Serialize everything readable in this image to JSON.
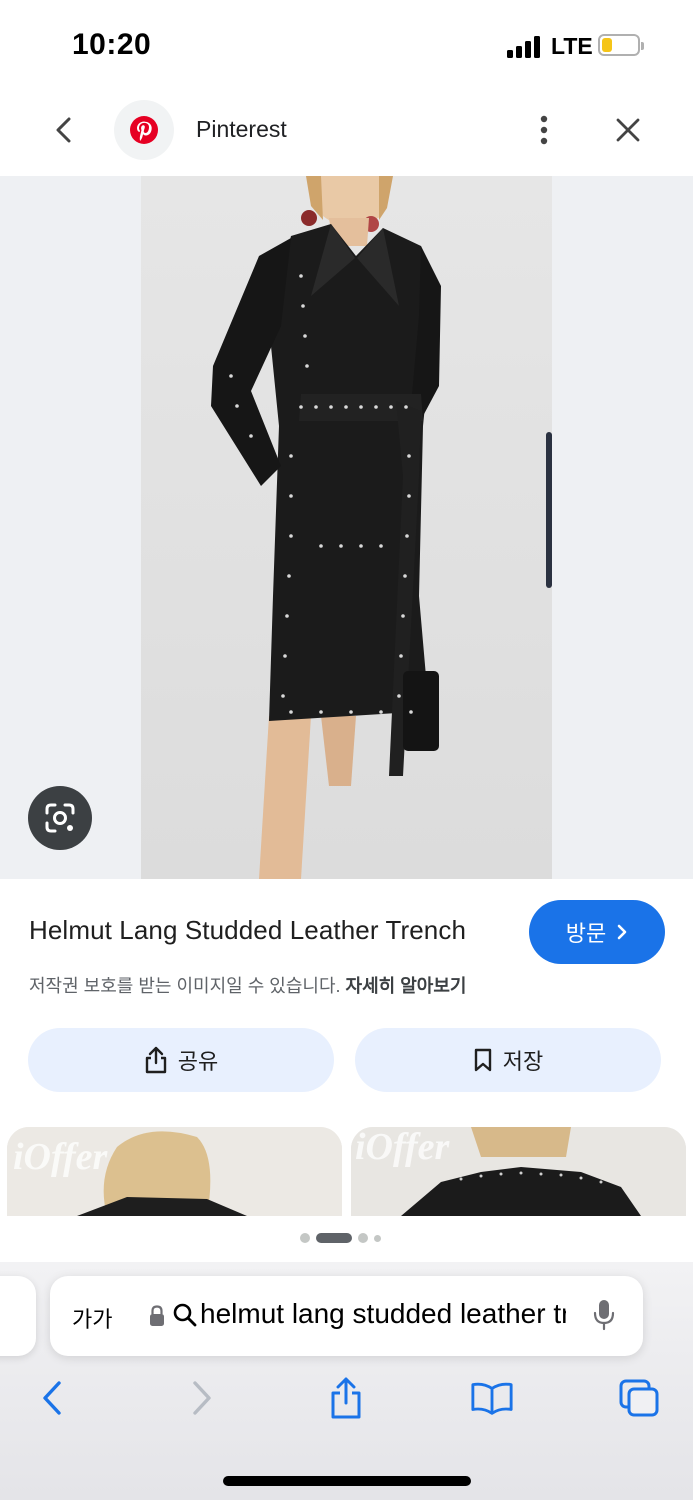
{
  "status_bar": {
    "time": "10:20",
    "network": "LTE",
    "battery_level": 0.3
  },
  "header": {
    "site_name": "Pinterest",
    "back_icon": "chevron-left-icon",
    "more_icon": "more-vert-icon",
    "close_icon": "close-icon",
    "logo_color": "#e60023"
  },
  "viewer": {
    "image_description": "studded-black-leather-trench-coat-photo",
    "lens_icon": "lens-icon"
  },
  "result": {
    "title": "Helmut Lang Studded Leather Trench",
    "visit_label": "방문",
    "copyright_notice": "저작권 보호를 받는 이미지일 수 있습니다.",
    "learn_more": "자세히 알아보기"
  },
  "actions": {
    "share_label": "공유",
    "save_label": "저장"
  },
  "related": {
    "watermark_1": "iOffer",
    "watermark_2": "iOffer"
  },
  "pager": {
    "page_count": 4,
    "active_index": 1
  },
  "safari": {
    "aa_label": "가가",
    "url": "helmut lang studded leather trench",
    "accent": "#1a73e8"
  }
}
